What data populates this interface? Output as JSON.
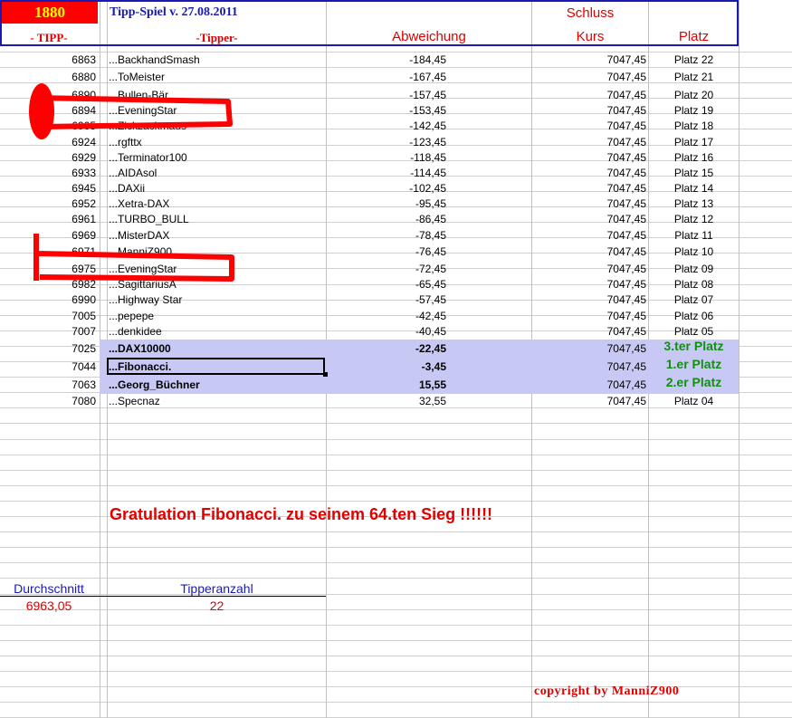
{
  "header": {
    "code": "1880",
    "subtitle": "Tipp-Spiel v. 27.08.2011",
    "schluss": "Schluss",
    "col_tipp": "- TIPP-",
    "col_tipper": "-Tipper-",
    "col_abweichung": "Abweichung",
    "col_kurs": "Kurs",
    "col_platz": "Platz"
  },
  "rows": [
    {
      "tipp": "6863",
      "name": "...BackhandSmash",
      "abw": "-184,45",
      "kurs": "7047,45",
      "platz": "Platz 22"
    },
    {
      "tipp": "6880",
      "name": "...ToMeister",
      "abw": "-167,45",
      "kurs": "7047,45",
      "platz": "Platz 21"
    },
    {
      "tipp": "6890",
      "name": "...Bullen-Bär",
      "abw": "-157,45",
      "kurs": "7047,45",
      "platz": "Platz 20"
    },
    {
      "tipp": "6894",
      "name": "...EveningStar",
      "abw": "-153,45",
      "kurs": "7047,45",
      "platz": "Platz 19"
    },
    {
      "tipp": "6905",
      "name": "...Zickzackmaus",
      "abw": "-142,45",
      "kurs": "7047,45",
      "platz": "Platz 18"
    },
    {
      "tipp": "6924",
      "name": "...rgfttx",
      "abw": "-123,45",
      "kurs": "7047,45",
      "platz": "Platz 17"
    },
    {
      "tipp": "6929",
      "name": "...Terminator100",
      "abw": "-118,45",
      "kurs": "7047,45",
      "platz": "Platz 16"
    },
    {
      "tipp": "6933",
      "name": "...AIDAsol",
      "abw": "-114,45",
      "kurs": "7047,45",
      "platz": "Platz 15"
    },
    {
      "tipp": "6945",
      "name": "...DAXii",
      "abw": "-102,45",
      "kurs": "7047,45",
      "platz": "Platz 14"
    },
    {
      "tipp": "6952",
      "name": "...Xetra-DAX",
      "abw": "-95,45",
      "kurs": "7047,45",
      "platz": "Platz 13"
    },
    {
      "tipp": "6961",
      "name": "...TURBO_BULL",
      "abw": "-86,45",
      "kurs": "7047,45",
      "platz": "Platz 12"
    },
    {
      "tipp": "6969",
      "name": "...MisterDAX",
      "abw": "-78,45",
      "kurs": "7047,45",
      "platz": "Platz 11"
    },
    {
      "tipp": "6971",
      "name": "...ManniZ900",
      "abw": "-76,45",
      "kurs": "7047,45",
      "platz": "Platz 10"
    },
    {
      "tipp": "6975",
      "name": "...EveningStar",
      "abw": "-72,45",
      "kurs": "7047,45",
      "platz": "Platz 09"
    },
    {
      "tipp": "6982",
      "name": "...SagittariusA",
      "abw": "-65,45",
      "kurs": "7047,45",
      "platz": "Platz 08"
    },
    {
      "tipp": "6990",
      "name": "...Highway Star",
      "abw": "-57,45",
      "kurs": "7047,45",
      "platz": "Platz 07"
    },
    {
      "tipp": "7005",
      "name": "...pepepe",
      "abw": "-42,45",
      "kurs": "7047,45",
      "platz": "Platz 06"
    },
    {
      "tipp": "7007",
      "name": "...denkidee",
      "abw": "-40,45",
      "kurs": "7047,45",
      "platz": "Platz 05"
    },
    {
      "tipp": "7025",
      "name": "...DAX10000",
      "abw": "-22,45",
      "kurs": "7047,45",
      "platz": "3.ter Platz"
    },
    {
      "tipp": "7044",
      "name": "...Fibonacci.",
      "abw": "-3,45",
      "kurs": "7047,45",
      "platz": "1.er Platz"
    },
    {
      "tipp": "7063",
      "name": "...Georg_Büchner",
      "abw": "15,55",
      "kurs": "7047,45",
      "platz": "2.er Platz"
    },
    {
      "tipp": "7080",
      "name": "...Specnaz",
      "abw": "32,55",
      "kurs": "7047,45",
      "platz": "Platz 04"
    }
  ],
  "gratulation": "Gratulation  Fibonacci. zu seinem 64.ten Sieg !!!!!!",
  "stats": {
    "avg_label": "Durchschnitt",
    "avg_value": "6963,05",
    "count_label": "Tipperanzahl",
    "count_value": "22"
  },
  "copyright": "copyright by ManniZ900",
  "colors": {
    "header_border": "#1a1ab0",
    "highlight": "#c8c8f4",
    "winner_text": "#109010",
    "accent_red": "#e00000",
    "annotation_red": "#ff0000"
  }
}
